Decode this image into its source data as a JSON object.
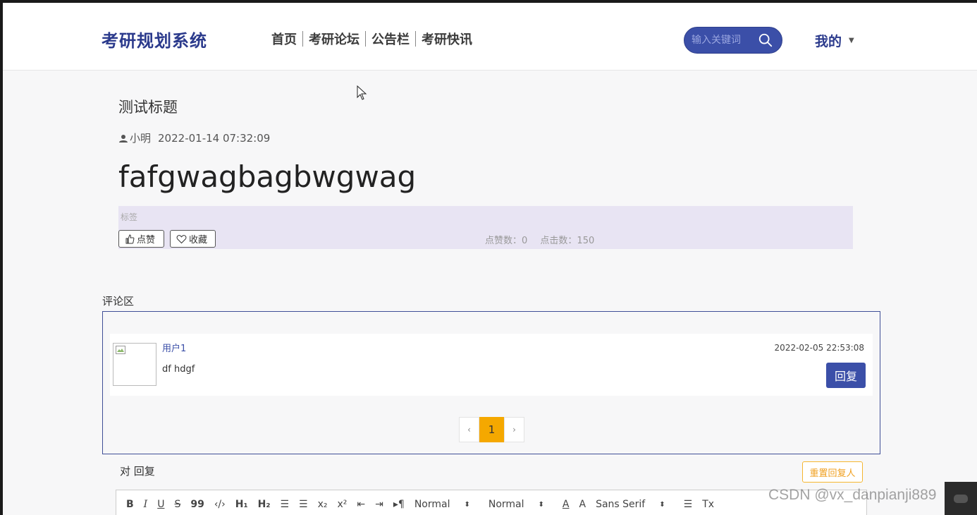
{
  "header": {
    "brand": "考研规划系统",
    "nav": [
      "首页",
      "考研论坛",
      "公告栏",
      "考研快讯"
    ],
    "search_placeholder": "输入关键词",
    "mine_label": "我的"
  },
  "article": {
    "title": "测试标题",
    "author": "小明",
    "date": "2022-01-14 07:32:09",
    "content": "fafgwagbagbwgwag",
    "tag_label": "标签",
    "like_label": "点赞",
    "fav_label": "收藏",
    "like_count_text": "点赞数：0",
    "click_count_text": "点击数：150"
  },
  "comments": {
    "title": "评论区",
    "items": [
      {
        "user": "用户1",
        "text": "df hdgf",
        "time": "2022-02-05 22:53:08",
        "reply_label": "回复"
      }
    ],
    "pager": {
      "prev": "‹",
      "current": "1",
      "next": "›"
    }
  },
  "reply_box": {
    "label": "对 回复",
    "reset_label": "重置回复人",
    "toolbar": {
      "bold": "B",
      "italic": "I",
      "underline": "U",
      "strike": "S",
      "quote": "99",
      "code": "‹/›",
      "h1": "H₁",
      "h2": "H₂",
      "ol": "☰",
      "ul": "☰",
      "sub": "x₂",
      "sup": "x²",
      "outdent": "⇤",
      "indent": "⇥",
      "direction": "▸¶",
      "size": "Normal",
      "header": "Normal",
      "color": "A",
      "background": "A",
      "font": "Sans Serif",
      "align": "☰",
      "clean": "Tx"
    }
  },
  "watermark": "CSDN @vx_danpianji889",
  "colors": {
    "brand": "#2b3a8c",
    "accent": "#3b4fa8",
    "page_active": "#f5a800",
    "tag_bg": "#e8e4f3"
  }
}
